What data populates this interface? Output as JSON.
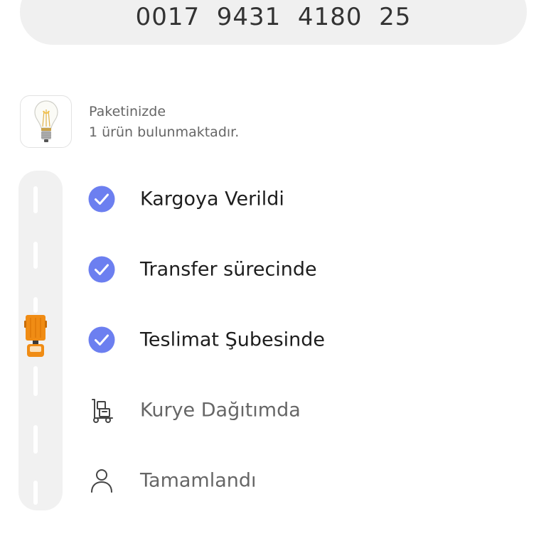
{
  "tracking": {
    "number": "0017  9431  4180  25"
  },
  "package": {
    "line1": "Paketinizde",
    "line2": "1 ürün bulunmaktadır.",
    "thumbnail_icon": "light-bulb-icon"
  },
  "steps": [
    {
      "label": "Kargoya Verildi",
      "status": "done",
      "icon": "check-circle-icon"
    },
    {
      "label": "Transfer sürecinde",
      "status": "done",
      "icon": "check-circle-icon"
    },
    {
      "label": "Teslimat Şubesinde",
      "status": "done",
      "icon": "check-circle-icon"
    },
    {
      "label": "Kurye Dağıtımda",
      "status": "pending",
      "icon": "courier-dolly-icon"
    },
    {
      "label": "Tamamlandı",
      "status": "pending",
      "icon": "person-icon"
    }
  ],
  "colors": {
    "accent": "#6c7ff0",
    "truck": "#f08c14",
    "link": "#f27a1a"
  },
  "truck_icon": "truck-icon",
  "bottom_link": {
    "label": ""
  }
}
